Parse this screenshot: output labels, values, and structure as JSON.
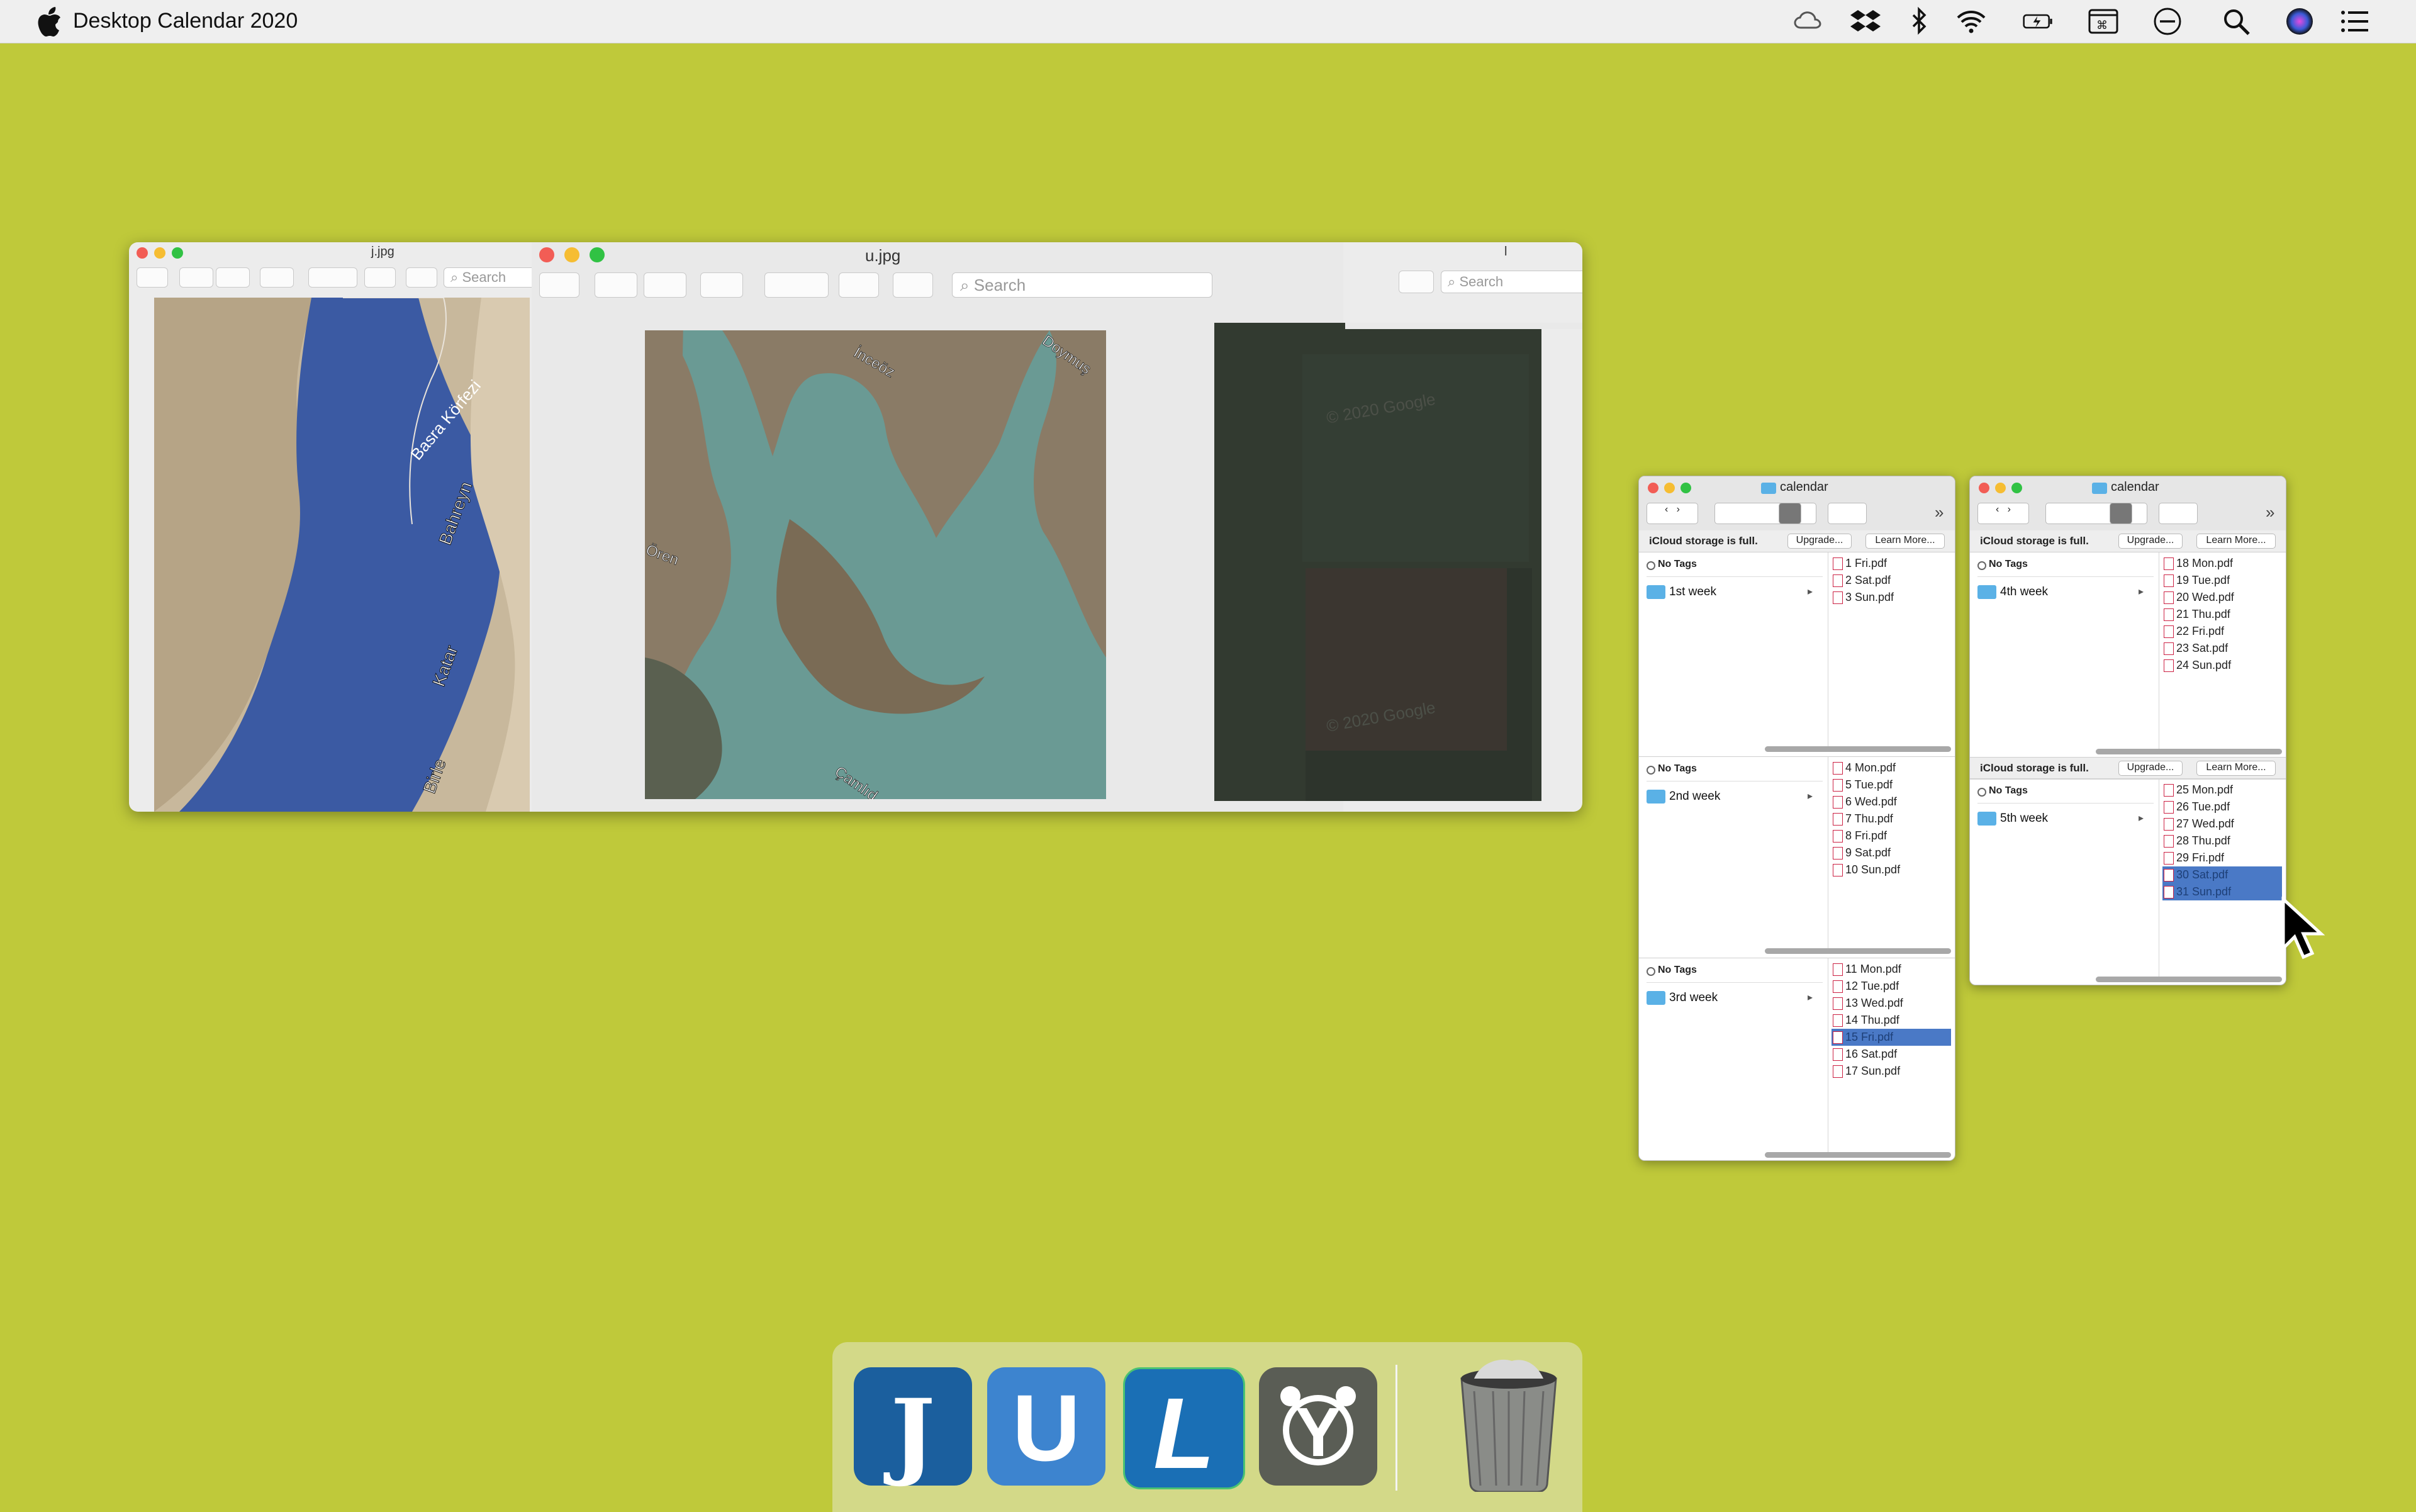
{
  "menubar": {
    "app_title": "Desktop Calendar 2020",
    "status_icons": [
      "creative-cloud-icon",
      "dropbox-icon",
      "bluetooth-icon",
      "wifi-icon",
      "battery-icon",
      "keyboard-viewer-icon",
      "do-not-disturb-icon",
      "spotlight-search-icon",
      "siri-icon",
      "notification-center-icon"
    ]
  },
  "preview": {
    "left_title": "j.jpg",
    "middle_title": "u.jpg",
    "right_title": "l",
    "search_placeholder": "Search",
    "map_labels": {
      "left": [
        "Basra Körfezi",
        "Bahreyn",
        "Katar",
        "Birle"
      ],
      "middle": [
        "İnceöz",
        "Doymuş",
        "Ören",
        "Çamlıd"
      ],
      "right": [
        "© 2020 Google",
        "© 2020 Google"
      ]
    }
  },
  "finder_left": {
    "title": "calendar",
    "banner": {
      "text": "iCloud storage is full.",
      "upgrade": "Upgrade...",
      "learn": "Learn More..."
    },
    "panes": [
      {
        "tag": "No Tags",
        "folder": "1st week",
        "files": [
          "1 Fri.pdf",
          "2 Sat.pdf",
          "3 Sun.pdf"
        ],
        "selected": -1
      },
      {
        "tag": "No Tags",
        "folder": "2nd week",
        "files": [
          "4 Mon.pdf",
          "5 Tue.pdf",
          "6 Wed.pdf",
          "7 Thu.pdf",
          "8 Fri.pdf",
          "9 Sat.pdf",
          "10 Sun.pdf"
        ],
        "selected": -1
      },
      {
        "tag": "No Tags",
        "folder": "3rd week",
        "files": [
          "11 Mon.pdf",
          "12 Tue.pdf",
          "13 Wed.pdf",
          "14 Thu.pdf",
          "15 Fri.pdf",
          "16 Sat.pdf",
          "17 Sun.pdf"
        ],
        "selected": 4
      }
    ]
  },
  "finder_right": {
    "title": "calendar",
    "banner": {
      "text": "iCloud storage is full.",
      "upgrade": "Upgrade...",
      "learn": "Learn More..."
    },
    "banner2": {
      "text": "iCloud storage is full.",
      "upgrade": "Upgrade...",
      "learn": "Learn More..."
    },
    "panes": [
      {
        "tag": "No Tags",
        "folder": "4th week",
        "files": [
          "18 Mon.pdf",
          "19 Tue.pdf",
          "20 Wed.pdf",
          "21 Thu.pdf",
          "22 Fri.pdf",
          "23 Sat.pdf",
          "24 Sun.pdf"
        ],
        "selected": -1
      },
      {
        "tag": "No Tags",
        "folder": "5th week",
        "files": [
          "25 Mon.pdf",
          "26 Tue.pdf",
          "27 Wed.pdf",
          "28 Thu.pdf",
          "29 Fri.pdf",
          "30 Sat.pdf",
          "31 Sun.pdf"
        ],
        "selected": [
          5,
          6
        ]
      }
    ]
  },
  "dock": {
    "apps": [
      {
        "name": "J",
        "letter": "J",
        "color": "#1b5f9e"
      },
      {
        "name": "U",
        "letter": "U",
        "color": "#3d84cf"
      },
      {
        "name": "L",
        "letter": "L",
        "color": "#1a6fb5"
      },
      {
        "name": "Y",
        "letter": "Y",
        "color": "#5a5d55"
      }
    ],
    "trash": "trash-icon"
  }
}
